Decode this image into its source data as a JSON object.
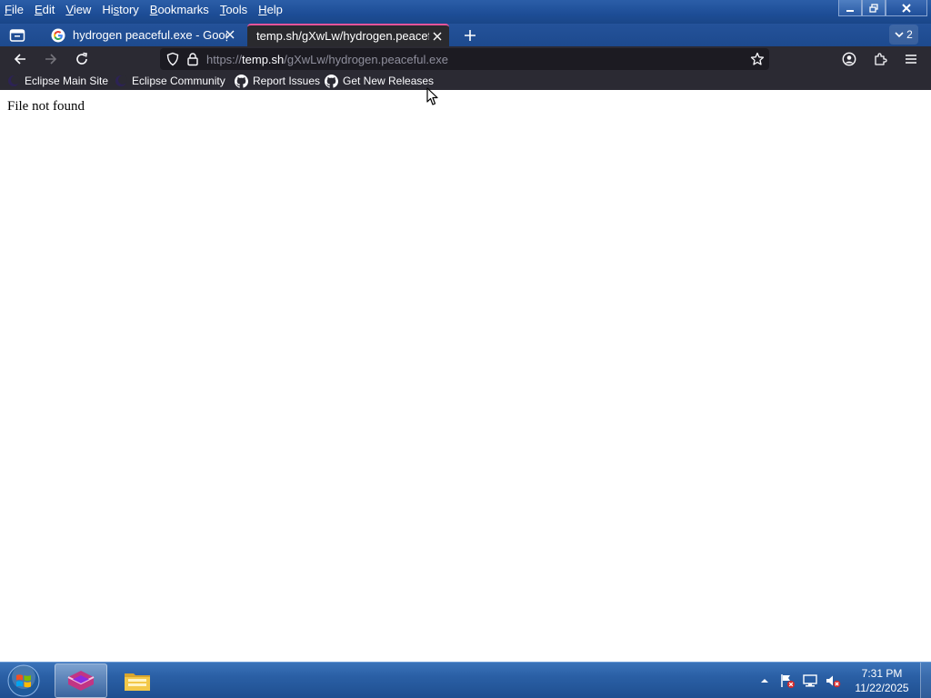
{
  "menu": {
    "items": [
      {
        "mnemonic": "F",
        "rest": "ile"
      },
      {
        "mnemonic": "E",
        "rest": "dit"
      },
      {
        "mnemonic": "V",
        "rest": "iew"
      },
      {
        "mnemonic": "H",
        "rest": "istory",
        "pre": "",
        "split": true
      },
      {
        "mnemonic": "B",
        "rest": "ookmarks"
      },
      {
        "mnemonic": "T",
        "rest": "ools"
      },
      {
        "mnemonic": "H",
        "rest": "elp"
      }
    ],
    "history_pre": "Hi",
    "history_mn": "s",
    "history_post": "tory"
  },
  "tabs": [
    {
      "title": "hydrogen peaceful.exe - Google",
      "favicon": "google-icon",
      "active": false
    },
    {
      "title": "temp.sh/gXwLw/hydrogen.peaceful",
      "active": true
    }
  ],
  "tab_count": "2",
  "url": {
    "scheme": "https://",
    "host": "temp.sh",
    "path": "/gXwLw/hydrogen.peaceful.exe"
  },
  "bookmarks": [
    {
      "label": "Eclipse Main Site",
      "icon": "eclipse-icon"
    },
    {
      "label": "Eclipse Community",
      "icon": "eclipse-icon"
    },
    {
      "label": "Report Issues",
      "icon": "github-icon"
    },
    {
      "label": "Get New Releases",
      "icon": "github-icon"
    }
  ],
  "page": {
    "message": "File not found"
  },
  "taskbar": {
    "time": "7:31 PM",
    "date": "11/22/2025"
  },
  "colors": {
    "active_tab_accent": "#e6549b",
    "toolbar_bg": "#2b2a33",
    "urlbar_bg": "#1c1b22"
  }
}
